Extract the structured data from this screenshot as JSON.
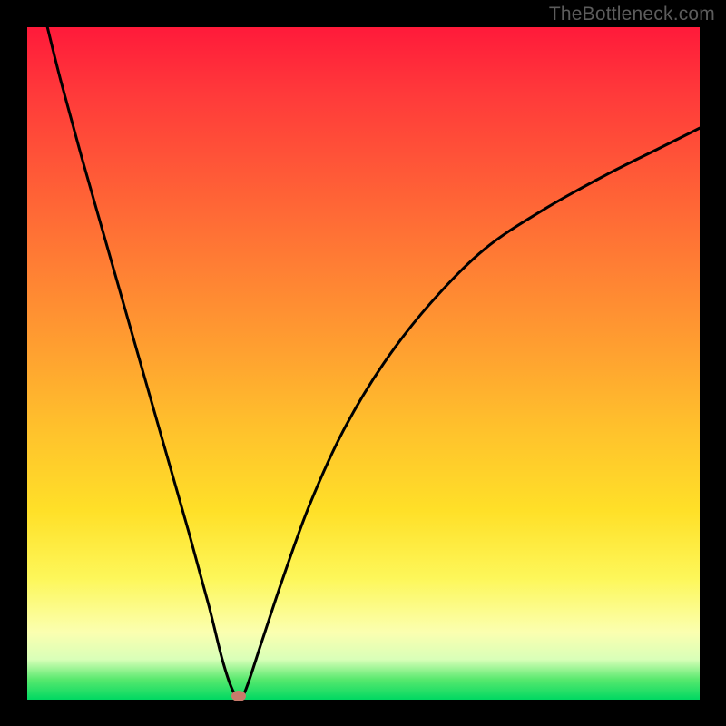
{
  "attribution": "TheBottleneck.com",
  "chart_data": {
    "type": "line",
    "title": "",
    "xlabel": "",
    "ylabel": "",
    "xlim": [
      0,
      100
    ],
    "ylim": [
      0,
      100
    ],
    "series": [
      {
        "name": "bottleneck-curve",
        "x": [
          3,
          5,
          8,
          12,
          16,
          20,
          24,
          27,
          29,
          30.5,
          31.5,
          32.5,
          35,
          38,
          42,
          47,
          53,
          60,
          68,
          77,
          86,
          94,
          100
        ],
        "values": [
          100,
          92,
          81,
          67,
          53,
          39,
          25,
          14,
          6,
          1.5,
          0.5,
          1.5,
          9,
          18,
          29,
          40,
          50,
          59,
          67,
          73,
          78,
          82,
          85
        ]
      }
    ],
    "marker": {
      "x": 31.5,
      "y": 0.5
    },
    "gradient_stops": [
      {
        "pct": 0,
        "color": "#ff1a3a"
      },
      {
        "pct": 10,
        "color": "#ff3a3a"
      },
      {
        "pct": 22,
        "color": "#ff5a37"
      },
      {
        "pct": 35,
        "color": "#ff7d34"
      },
      {
        "pct": 48,
        "color": "#ffa030"
      },
      {
        "pct": 60,
        "color": "#ffc22c"
      },
      {
        "pct": 72,
        "color": "#ffe028"
      },
      {
        "pct": 82,
        "color": "#fdf75a"
      },
      {
        "pct": 90,
        "color": "#fbffb0"
      },
      {
        "pct": 94,
        "color": "#d9ffb8"
      },
      {
        "pct": 97,
        "color": "#58e96e"
      },
      {
        "pct": 100,
        "color": "#00d862"
      }
    ]
  }
}
